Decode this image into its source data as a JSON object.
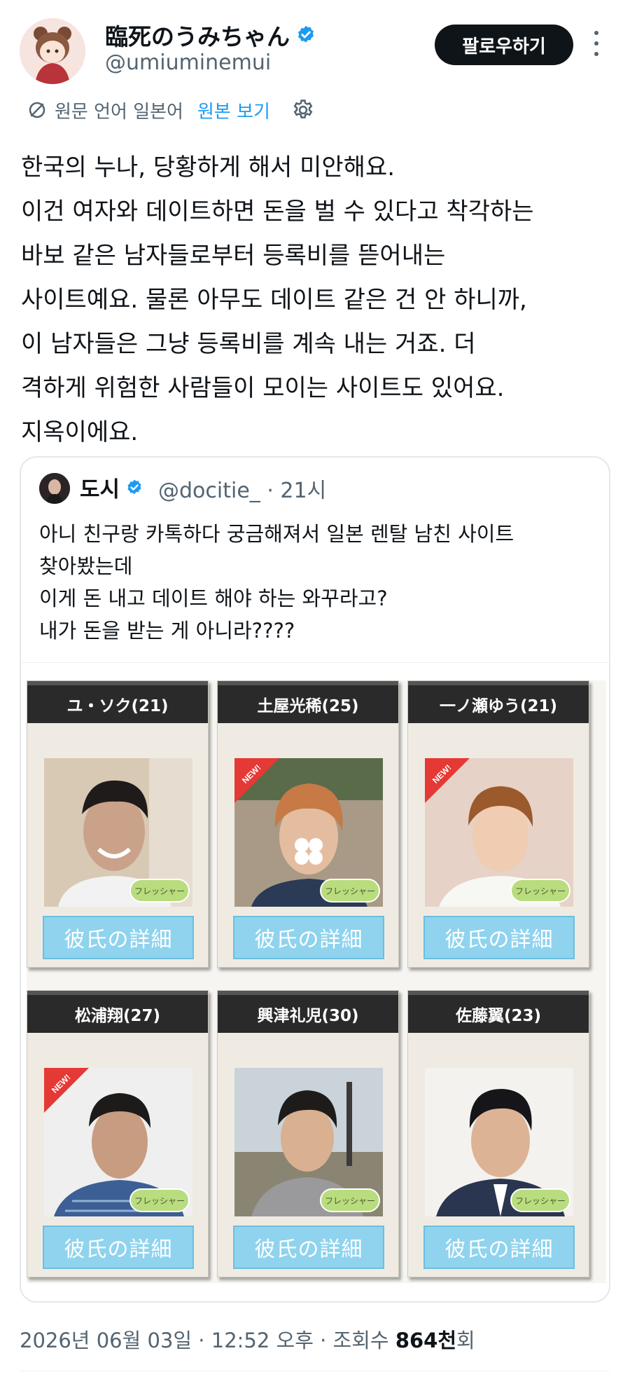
{
  "author": {
    "display_name": "臨死のうみちゃん",
    "handle": "@umiuminemui",
    "verified": true
  },
  "follow_button": "팔로우하기",
  "translation": {
    "note": "원문 언어 일본어",
    "show_original": "원본 보기"
  },
  "tweet_text": "한국의 누나, 당황하게 해서 미안해요.\n이건 여자와 데이트하면 돈을 벌 수 있다고 착각하는\n바보 같은 남자들로부터 등록비를 뜯어내는\n사이트예요. 물론 아무도 데이트 같은 건 안 하니까,\n이 남자들은 그냥 등록비를 계속 내는 거죠. 더\n격하게 위험한 사람들이 모이는 사이트도 있어요.\n지옥이에요.",
  "quote": {
    "display_name": "도시",
    "handle": "@docitie_ · 21시",
    "text": "아니 친구랑 카톡하다 궁금해져서 일본 렌탈 남친 사이트\n찾아봤는데\n이게 돈 내고 데이트 해야 하는 와꾸라고?\n내가 돈을 받는 게 아니라????"
  },
  "profiles": [
    {
      "name": "ユ・ソク(21)",
      "badge": "フレッシャー",
      "button": "彼氏の詳細",
      "new": false,
      "ribbon_text": ""
    },
    {
      "name": "土屋光稀(25)",
      "badge": "フレッシャー",
      "button": "彼氏の詳細",
      "new": true,
      "ribbon_text": "NEW!"
    },
    {
      "name": "一ノ瀬ゆう(21)",
      "badge": "フレッシャー",
      "button": "彼氏の詳細",
      "new": true,
      "ribbon_text": "NEW!"
    },
    {
      "name": "松浦翔(27)",
      "badge": "フレッシャー",
      "button": "彼氏の詳細",
      "new": true,
      "ribbon_text": "NEW!"
    },
    {
      "name": "興津礼児(30)",
      "badge": "フレッシャー",
      "button": "彼氏の詳細",
      "new": false,
      "ribbon_text": ""
    },
    {
      "name": "佐藤翼(23)",
      "badge": "フレッシャー",
      "button": "彼氏の詳細",
      "new": false,
      "ribbon_text": ""
    }
  ],
  "timestamp": {
    "date_time": "2026년 06월 03일 · 12:52 오후 · 조회수 ",
    "views": "864천",
    "suffix": "회"
  },
  "colors": {
    "accent": "#1d9bf0",
    "verified": "#1d9bf0",
    "follow_bg": "#0f1419",
    "detail_button": "#8fd3ee",
    "fresh_badge": "#b9dc7e",
    "new_ribbon": "#e53935"
  },
  "icons": [
    "verified-badge-icon",
    "translate-icon",
    "gear-icon",
    "more-icon"
  ]
}
